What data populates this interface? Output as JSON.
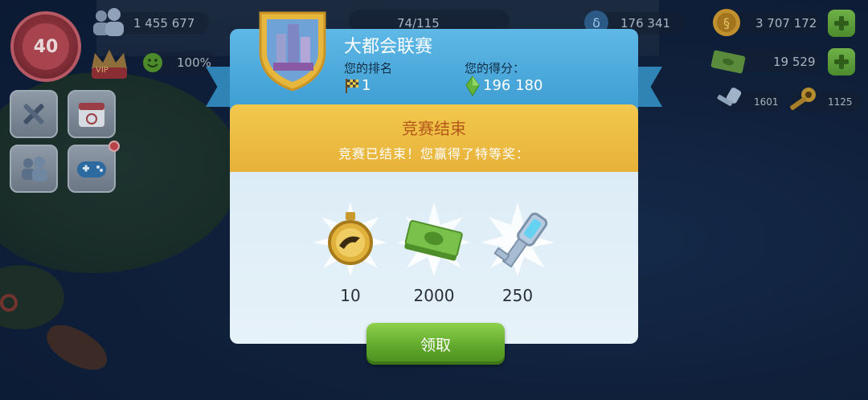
{
  "hud": {
    "level": "40",
    "population": "1 455 677",
    "happiness": "100%",
    "vip_label": "VIP",
    "storage": "74/115",
    "neosimoleons": "176 341",
    "simoleons": "3 707 172",
    "simcash": "19 529",
    "keys_platinum": "1601",
    "keys_golden": "1125"
  },
  "dialog": {
    "title": "大都会联赛",
    "rank_label": "您的排名",
    "rank_value": "1",
    "score_label": "您的得分：",
    "score_value": "196 180",
    "banner_title": "竞赛结束",
    "banner_subtitle": "竞赛已结束！您赢得了特等奖：",
    "rewards": [
      {
        "icon": "speedup-stopwatch-icon",
        "amount": "10"
      },
      {
        "icon": "simcash-money-icon",
        "amount": "2000"
      },
      {
        "icon": "platinum-key-icon",
        "amount": "250"
      }
    ],
    "claim_label": "领取"
  },
  "colors": {
    "header_blue": "#3a9ad0",
    "gold_banner": "#e8b23a",
    "claim_green": "#5ea62a"
  }
}
